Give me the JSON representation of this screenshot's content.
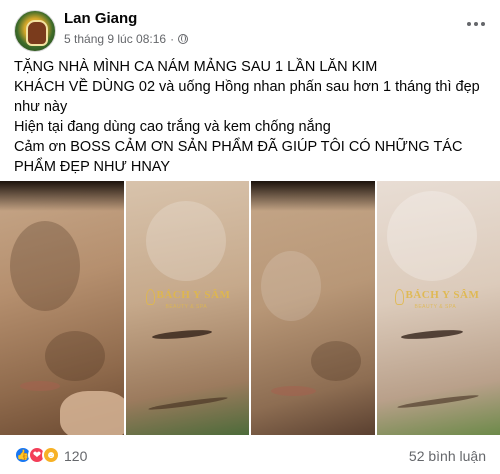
{
  "post": {
    "author": "Lan Giang",
    "date": "5 tháng 9 lúc 08:16",
    "separator": "·",
    "privacy_icon": "globe-icon",
    "more_icon": "more-horizontal-icon",
    "lines": [
      "TẶNG NHÀ MÌNH CA NÁM MẢNG SAU 1 LẦN LĂN KIM",
      "KHÁCH VỀ DÙNG 02 và uống Hồng nhan phấn sau hơn 1 tháng thì đẹp như này",
      "Hiện tại đang dùng cao trắng và kem chống nắng",
      "Cảm ơn BOSS CẢM ƠN SẢN PHẨM ĐÃ GIÚP TÔI CÓ NHỮNG TÁC PHẨM ĐẸP NHƯ HNAY"
    ]
  },
  "photos": {
    "watermark": "BÁCH Y SÂM",
    "watermark_sub": "BEAUTY & SPA"
  },
  "footer": {
    "reactions": [
      "like-icon",
      "love-icon",
      "haha-icon"
    ],
    "reaction_count": "120",
    "comments": "52 bình luận"
  },
  "colors": {
    "link_blue": "#1877f2",
    "secondary_text": "#65676b",
    "watermark_gold": "#e0b84a"
  }
}
